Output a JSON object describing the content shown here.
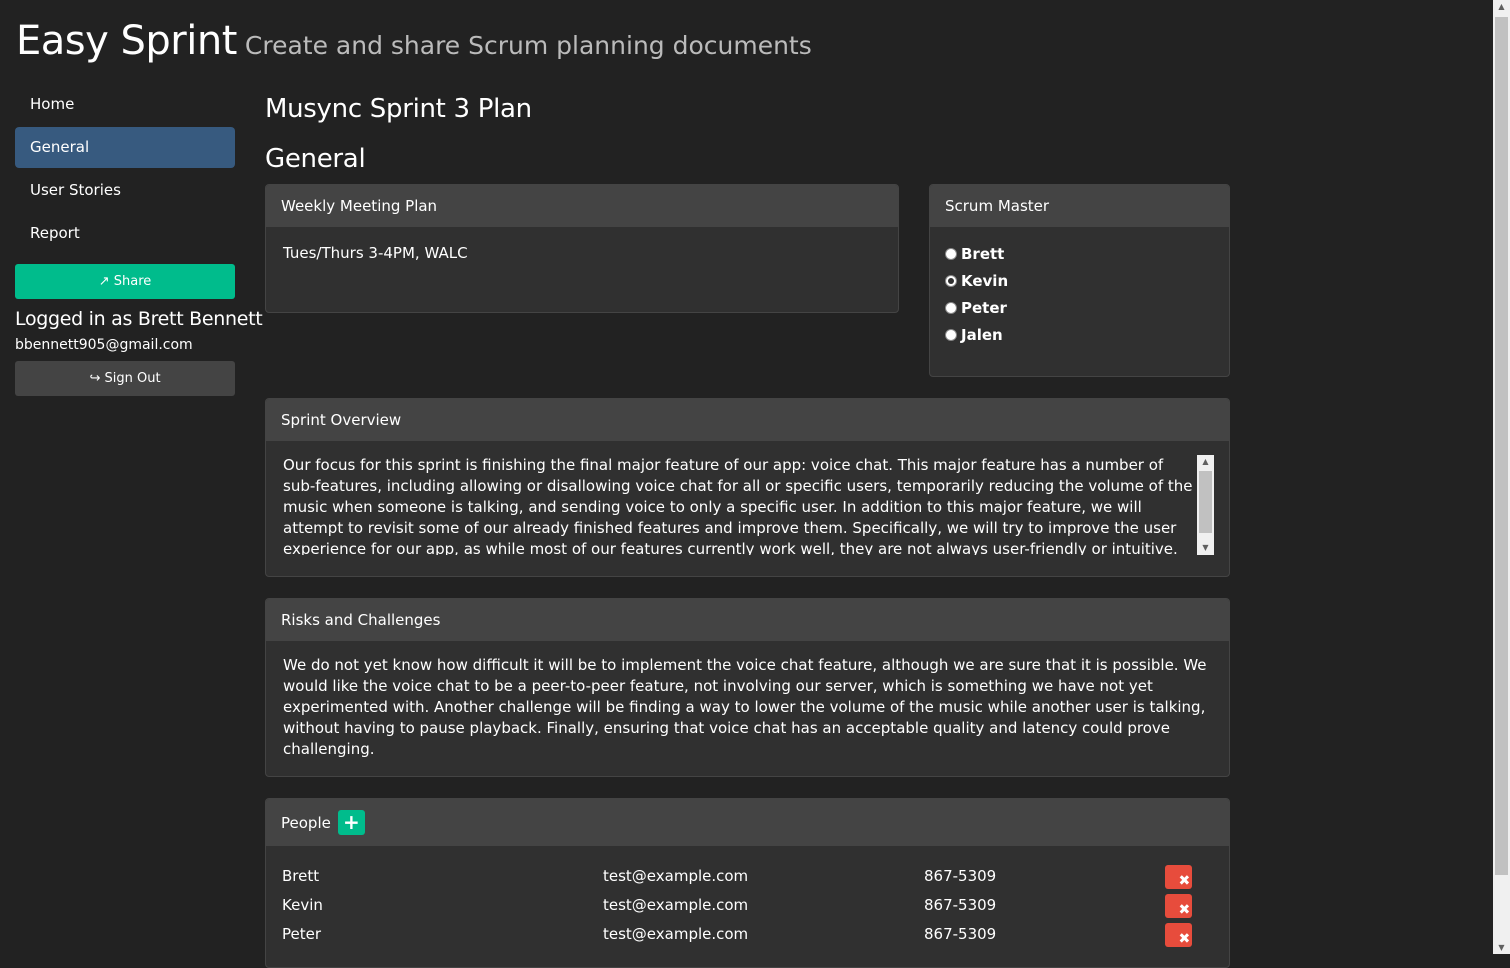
{
  "header": {
    "title": "Easy Sprint",
    "subtitle": "Create and share Scrum planning documents"
  },
  "sidebar": {
    "items": [
      {
        "label": "Home",
        "active": false
      },
      {
        "label": "General",
        "active": true
      },
      {
        "label": "User Stories",
        "active": false
      },
      {
        "label": "Report",
        "active": false
      }
    ],
    "share_label": "Share",
    "logged_in_text": "Logged in as Brett Bennett",
    "email": "bbennett905@gmail.com",
    "signout_label": "Sign Out"
  },
  "main": {
    "plan_title": "Musync Sprint 3 Plan",
    "section_title": "General",
    "weekly_meeting": {
      "heading": "Weekly Meeting Plan",
      "text": "Tues/Thurs 3-4PM, WALC"
    },
    "scrum_master": {
      "heading": "Scrum Master",
      "options": [
        "Brett",
        "Kevin",
        "Peter",
        "Jalen"
      ],
      "selected": "Kevin"
    },
    "sprint_overview": {
      "heading": "Sprint Overview",
      "text": "Our focus for this sprint is finishing the final major feature of our app: voice chat. This major feature has a number of sub-features, including allowing or disallowing voice chat for all or specific users, temporarily reducing the volume of the music when someone is talking, and sending voice to only a specific user. In addition to this major feature, we will attempt to revisit some of our already finished features and improve them. Specifically, we will try to improve the user experience for our app, as while most of our features currently work well, they are not always user-friendly or intuitive."
    },
    "risks": {
      "heading": "Risks and Challenges",
      "text": "We do not yet know how difficult it will be to implement the voice chat feature, although we are sure that it is possible. We would like the voice chat to be a peer-to-peer feature, not involving our server, which  is something we have not yet experimented with. Another challenge will be finding a way to lower the volume of the music while another user is talking, without having to pause playback. Finally, ensuring that voice chat has an acceptable quality and latency could prove challenging."
    },
    "people": {
      "heading": "People",
      "rows": [
        {
          "name": "Brett",
          "email": "test@example.com",
          "phone": "867-5309"
        },
        {
          "name": "Kevin",
          "email": "test@example.com",
          "phone": "867-5309"
        },
        {
          "name": "Peter",
          "email": "test@example.com",
          "phone": "867-5309"
        }
      ]
    }
  },
  "colors": {
    "background": "#222222",
    "panel": "#303030",
    "panel_heading": "#444444",
    "active_nav": "#375a7f",
    "success": "#00bc8c",
    "danger": "#e74c3c"
  }
}
